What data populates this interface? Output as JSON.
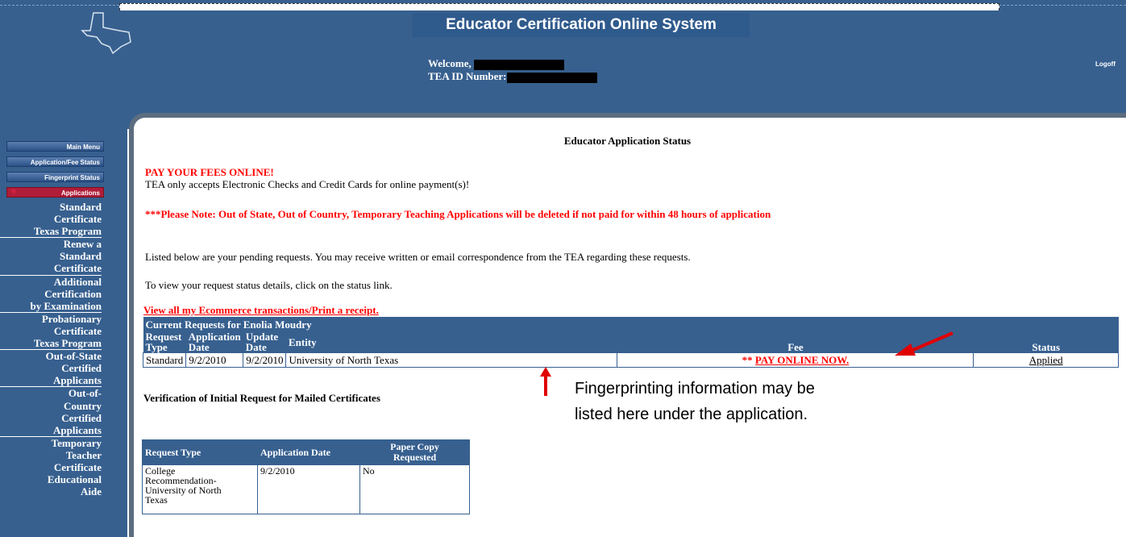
{
  "header": {
    "system_title": "Educator Certification Online System",
    "welcome_label": "Welcome,",
    "tea_id_label": "TEA ID Number:",
    "logout_label": "Logoff"
  },
  "sidebar": {
    "buttons": [
      {
        "label": "Main Menu"
      },
      {
        "label": "Application/Fee Status"
      },
      {
        "label": "Fingerprint Status"
      },
      {
        "label": "Applications"
      }
    ],
    "links": [
      "Standard",
      "Certificate",
      "Texas Program",
      "Renew a",
      "Standard",
      "Certificate",
      "Additional",
      "Certification",
      "by Examination",
      "Probationary",
      "Certificate",
      "Texas Program",
      "Out-of-State",
      "Certified",
      "Applicants",
      "Out-of-",
      "Country",
      "Certified",
      "Applicants",
      "Temporary",
      "Teacher",
      "Certificate",
      "Educational",
      "Aide"
    ]
  },
  "main": {
    "page_title": "Educator Application Status",
    "pay_heading": "PAY YOUR FEES ONLINE!",
    "pay_info": "TEA only accepts Electronic Checks and Credit Cards for online payment(s)!",
    "note": "***Please Note: Out of State, Out of Country, Temporary Teaching Applications will be deleted if not paid for within 48 hours of application",
    "pending_text": "Listed below are your pending requests. You may receive written or email correspondence from the TEA regarding these requests.",
    "status_hint": "To view your request status details, click on the status link.",
    "ecommerce_link": "View all my Ecommerce transactions/Print a receipt.",
    "requests_table": {
      "caption": "Current Requests for Enolia Moudry",
      "headers": {
        "request_type_1": "Request",
        "request_type_2": "Type",
        "app_date_1": "Application",
        "app_date_2": "Date",
        "update_date_1": "Update",
        "update_date_2": "Date",
        "entity": "Entity",
        "fee": "Fee",
        "status": "Status"
      },
      "row": {
        "request_type": "Standard",
        "application_date": "9/2/2010",
        "update_date": "9/2/2010",
        "entity": "University of North Texas",
        "fee_prefix": "**",
        "fee_link": "PAY ONLINE NOW.",
        "status": "Applied"
      }
    },
    "verification_title": "Verification of Initial Request for Mailed Certificates",
    "verification_table": {
      "headers": {
        "request_type": "Request Type",
        "application_date": "Application Date",
        "paper_copy_1": "Paper Copy",
        "paper_copy_2": "Requested"
      },
      "row": {
        "request_type_lines": [
          "College",
          "Recommendation-",
          "University of North",
          "Texas"
        ],
        "application_date": "9/2/2010",
        "paper_copy": "No"
      }
    }
  },
  "annotation": {
    "line1": "Fingerprinting information may be",
    "line2": "listed here under the application.",
    "arrow_color": "#e00000"
  }
}
